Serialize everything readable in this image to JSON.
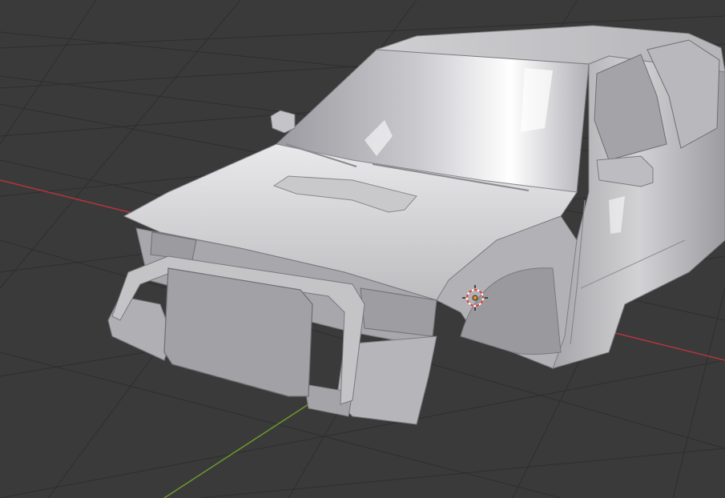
{
  "app": "3D Viewport",
  "viewport": {
    "background_color": "#3a3a3a",
    "grid_color": "#2f2f2f",
    "x_axis_color": "#b3353f",
    "y_axis_color": "#6e9a2b",
    "object_color": "#bfbfc1",
    "object_shadow_color": "#8e8e91",
    "object_highlight_color": "#ffffff",
    "origin_marker_color": "#f08a24",
    "cursor_ring_colors": [
      "#ffffff",
      "#e23b3b"
    ]
  },
  "scene": {
    "object": "car-body-mesh",
    "icons": {
      "cursor": "3d-cursor-icon",
      "origin": "object-origin-icon"
    }
  }
}
